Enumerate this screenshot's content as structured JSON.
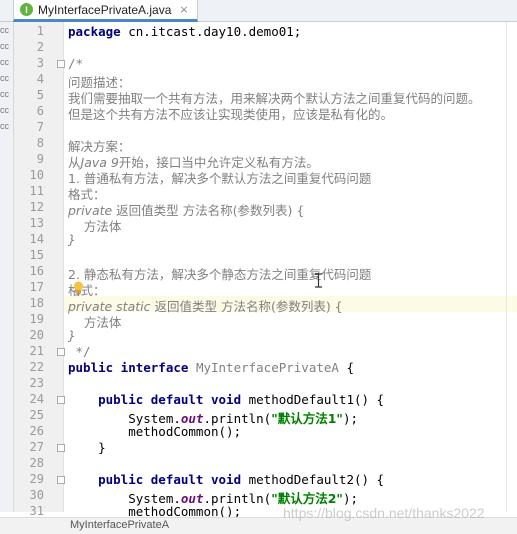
{
  "tab": {
    "icon_letter": "I",
    "filename": "MyInterfacePrivateA.java",
    "close_glyph": "×"
  },
  "sidebar_labels": [
    "cc",
    "cc",
    "cc",
    "cc",
    "cc",
    "cc",
    "cc"
  ],
  "line_numbers": [
    "1",
    "2",
    "3",
    "4",
    "5",
    "6",
    "7",
    "8",
    "9",
    "10",
    "11",
    "12",
    "13",
    "14",
    "15",
    "16",
    "17",
    "18",
    "19",
    "20",
    "21",
    "22",
    "23",
    "24",
    "25",
    "26",
    "27",
    "28",
    "29",
    "30",
    "31"
  ],
  "code": {
    "l1_kw": "package",
    "l1_rest": " cn.itcast.day10.demo01;",
    "l3": "/*",
    "l4": "问题描述：",
    "l5": "我们需要抽取一个共有方法，用来解决两个默认方法之间重复代码的问题。",
    "l6": "但是这个共有方法不应该让实现类使用，应该是私有化的。",
    "l8": "解决方案：",
    "l9_a": "从",
    "l9_b": "Java 9",
    "l9_c": "开始，接口当中允许定义私有方法。",
    "l10": "1. 普通私有方法，解决多个默认方法之间重复代码问题",
    "l11": "格式：",
    "l12_a": "private",
    "l12_b": " 返回值类型 方法名称(参数列表) {",
    "l13": "    方法体",
    "l14": "}",
    "l16": "2. 静态私有方法，解决多个静态方法之间重复代码问题",
    "l17": "格式：",
    "l18_a": "private static",
    "l18_b": " 返回值类型 方法名称(参数列表) {",
    "l19": "    方法体",
    "l20": "}",
    "l21": " */",
    "l22_kw": "public interface",
    "l22_name": " MyInterfacePrivateA",
    "l22_end": " {",
    "l24_kw": "    public default void",
    "l24_rest": " methodDefault1() {",
    "l25_a": "        System.",
    "l25_b": "out",
    "l25_c": ".println(",
    "l25_str": "\"默认方法1\"",
    "l25_d": ");",
    "l26": "        methodCommon();",
    "l27": "    }",
    "l29_kw": "    public default void",
    "l29_rest": " methodDefault2() {",
    "l30_a": "        System.",
    "l30_b": "out",
    "l30_c": ".println(",
    "l30_str": "\"默认方法2\"",
    "l30_d": ");",
    "l31": "        methodCommon();"
  },
  "status": {
    "breadcrumb": "MyInterfacePrivateA"
  },
  "watermark": "https://blog.csdn.net/thanks2022",
  "colors": {
    "keyword": "#000080",
    "comment": "#808080",
    "string": "#008000",
    "field": "#660e7a",
    "highlight_line": "#fdfbe5",
    "tab_underline": "#4a88c7"
  }
}
